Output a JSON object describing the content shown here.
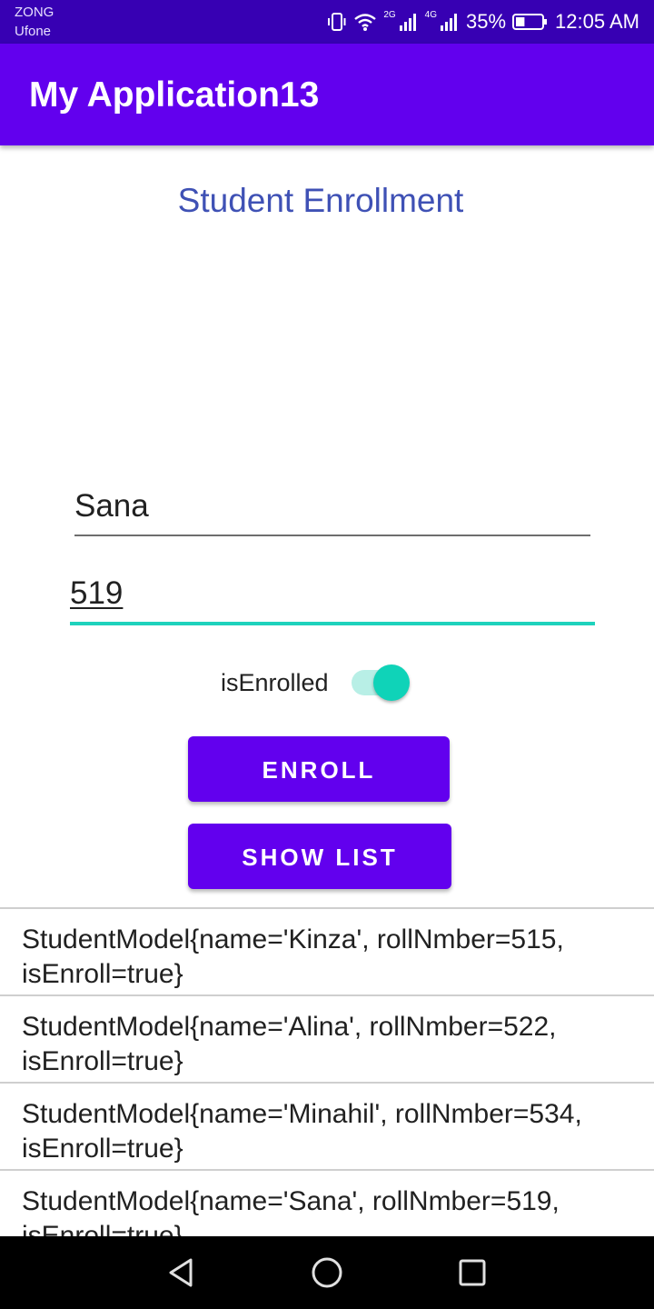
{
  "status_bar": {
    "carrier_1": "ZONG",
    "carrier_2": "Ufone",
    "network_1": "2G",
    "network_2": "4G",
    "battery": "35%",
    "battery_level": 0.35,
    "time": "12:05 AM",
    "icons": [
      "vibrate-icon",
      "wifi-icon",
      "signal-icon",
      "signal-icon",
      "battery-icon"
    ]
  },
  "app_bar": {
    "title": "My Application13"
  },
  "form": {
    "heading": "Student Enrollment",
    "name_value": "Sana",
    "roll_value": "519",
    "switch_label": "isEnrolled",
    "switch_on": true,
    "enroll_label": "ENROLL",
    "show_list_label": "SHOW LIST"
  },
  "list": {
    "items": [
      {
        "line1": "StudentModel{name='Kinza', rollNmber=515,",
        "line2": "isEnroll=true}"
      },
      {
        "line1": "StudentModel{name='Alina', rollNmber=522,",
        "line2": "isEnroll=true}"
      },
      {
        "line1": "StudentModel{name='Minahil', rollNmber=534,",
        "line2": "isEnroll=true}"
      },
      {
        "line1": "StudentModel{name='Sana', rollNmber=519,",
        "line2": "isEnroll=true}"
      }
    ]
  },
  "nav_bar": {
    "icons": [
      "back-icon",
      "home-icon",
      "recent-apps-icon"
    ]
  },
  "colors": {
    "status_bar": "#3700b3",
    "primary": "#6200ee",
    "accent": "#1ed2bc",
    "heading": "#3f51b5"
  }
}
